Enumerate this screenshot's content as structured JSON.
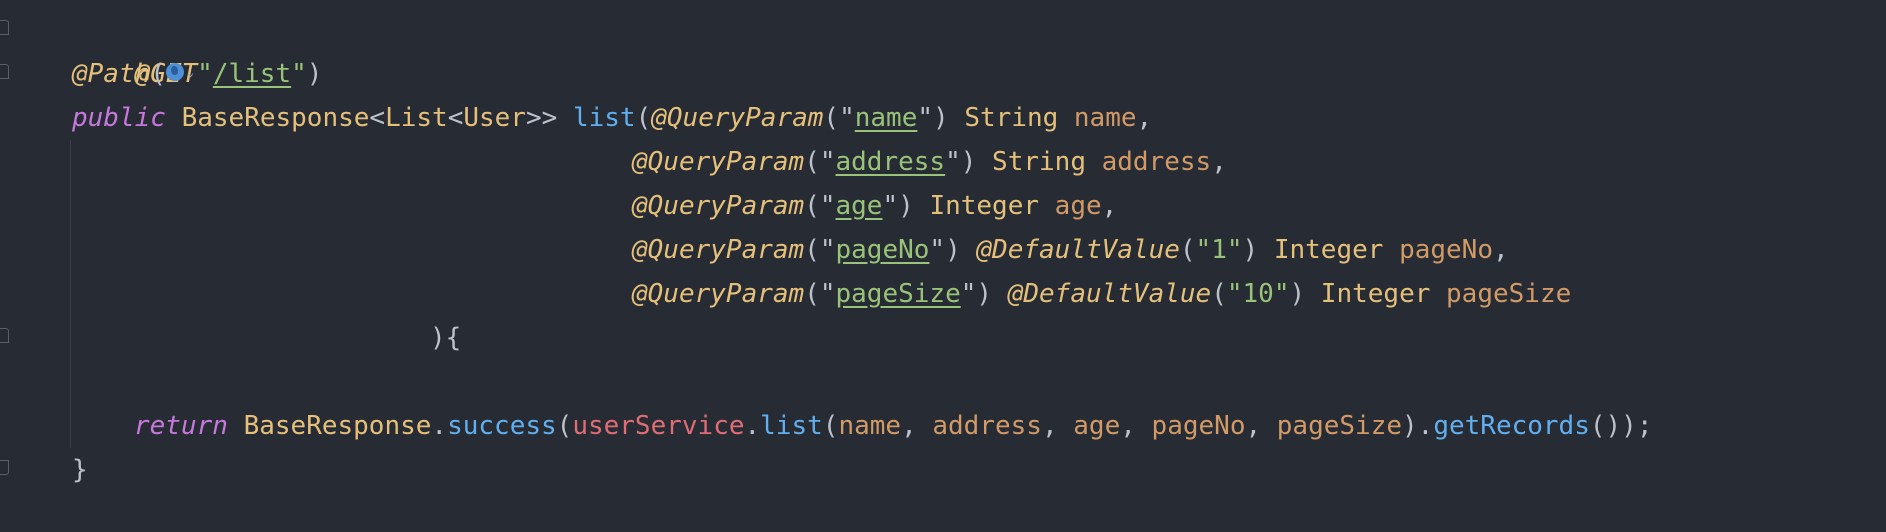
{
  "code": {
    "l1_ann": "@GET",
    "l2_ann": "@Path",
    "l2_open": "(",
    "l2_q1": "\"",
    "l2_path": "/list",
    "l2_q2": "\"",
    "l2_close": ")",
    "l3_kw": "public",
    "l3_type1": "BaseResponse",
    "l3_lt1": "<",
    "l3_type2": "List",
    "l3_lt2": "<",
    "l3_type3": "User",
    "l3_gt": ">>",
    "l3_fn": "list",
    "l3_open": "(",
    "l3_ann": "@QueryParam",
    "l3_p_open": "(\"",
    "l3_key": "name",
    "l3_p_close": "\")",
    "l3_ptype": "String",
    "l3_param": "name",
    "l3_comma": ",",
    "l4_ann": "@QueryParam",
    "l4_p_open": "(\"",
    "l4_key": "address",
    "l4_p_close": "\")",
    "l4_ptype": "String",
    "l4_param": "address",
    "l4_comma": ",",
    "l5_ann": "@QueryParam",
    "l5_p_open": "(\"",
    "l5_key": "age",
    "l5_p_close": "\")",
    "l5_ptype": "Integer",
    "l5_param": "age",
    "l5_comma": ",",
    "l6_ann": "@QueryParam",
    "l6_p_open": "(\"",
    "l6_key": "pageNo",
    "l6_p_close": "\")",
    "l6_ann2": "@DefaultValue",
    "l6_d_open": "(",
    "l6_default": "\"1\"",
    "l6_d_close": ")",
    "l6_ptype": "Integer",
    "l6_param": "pageNo",
    "l6_comma": ",",
    "l7_ann": "@QueryParam",
    "l7_p_open": "(\"",
    "l7_key": "pageSize",
    "l7_p_close": "\")",
    "l7_ann2": "@DefaultValue",
    "l7_d_open": "(",
    "l7_default": "\"10\"",
    "l7_d_close": ")",
    "l7_ptype": "Integer",
    "l7_param": "pageSize",
    "l8_brace": "){",
    "l10_kw": "return",
    "l10_type": "BaseResponse",
    "l10_dot1": ".",
    "l10_fn1": "success",
    "l10_open1": "(",
    "l10_field": "userService",
    "l10_dot2": ".",
    "l10_fn2": "list",
    "l10_open2": "(",
    "l10_a1": "name",
    "l10_c1": ", ",
    "l10_a2": "address",
    "l10_c2": ", ",
    "l10_a3": "age",
    "l10_c3": ", ",
    "l10_a4": "pageNo",
    "l10_c4": ", ",
    "l10_a5": "pageSize",
    "l10_close2": ").",
    "l10_fn3": "getRecords",
    "l10_end": "());",
    "l11_brace": "}"
  },
  "colors": {
    "background": "#272b33",
    "annotation": "#e5c07b",
    "keyword": "#c678dd",
    "function": "#61afef",
    "parameter": "#d19a66",
    "field": "#e06c75",
    "string": "#98c379"
  },
  "icons": {
    "web_reference": "globe-icon",
    "dropdown": "chevron-down-icon"
  }
}
